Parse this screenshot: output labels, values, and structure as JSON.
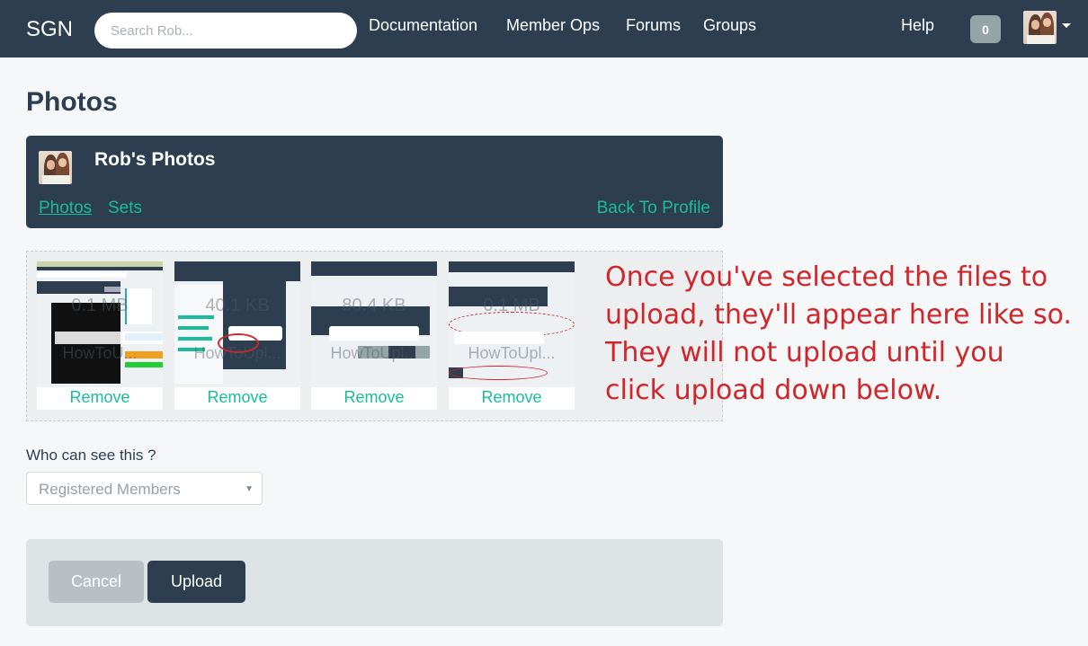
{
  "navbar": {
    "brand": "SGN",
    "search_placeholder": "Search Rob...",
    "links": [
      "Documentation",
      "Member Ops",
      "Forums",
      "Groups"
    ],
    "help": "Help",
    "notification_count": "0"
  },
  "page": {
    "title": "Photos"
  },
  "photos_header": {
    "title": "Rob's Photos",
    "tab_photos": "Photos",
    "tab_sets": "Sets",
    "back_link": "Back To Profile"
  },
  "dropzone": {
    "files": [
      {
        "size": "0.1 MB",
        "name": "HowToU...",
        "remove": "Remove"
      },
      {
        "size": "40.1 KB",
        "name": "HowToUpl...",
        "remove": "Remove"
      },
      {
        "size": "80.4 KB",
        "name": "HowToUpl...",
        "remove": "Remove"
      },
      {
        "size": "0.1 MB",
        "name": "HowToUpl...",
        "remove": "Remove"
      }
    ]
  },
  "annotation": "Once you've selected the files to upload, they'll appear here like so. They will not upload until you click upload down below.",
  "visibility": {
    "label": "Who can see this ?",
    "selected": "Registered Members"
  },
  "actions": {
    "cancel": "Cancel",
    "upload": "Upload"
  },
  "colors": {
    "navbar": "#2c3e50",
    "accent": "#1abc9c",
    "annotation": "#d0262a"
  }
}
